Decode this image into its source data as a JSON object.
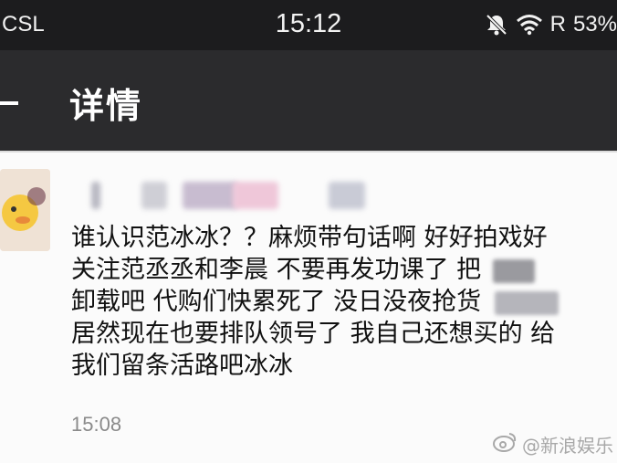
{
  "status_bar": {
    "carrier": "CSL",
    "time": "15:12",
    "network_label": "R",
    "battery": "53%",
    "icons": [
      "bell-muted-icon",
      "wifi-icon"
    ]
  },
  "header": {
    "back_icon": "back-arrow-icon",
    "title": "详情"
  },
  "message": {
    "lines": [
      "谁认识范冰冰？？麻烦带句话啊 好好拍戏好",
      "关注范丞丞和李晨 不要再发功课了 把",
      "卸载吧 代购们快累死了 没日没夜抢货",
      "居然现在也要排队领号了 我自己还想买的 给",
      "我们留条活路吧冰冰"
    ],
    "time": "15:08"
  },
  "watermark": {
    "text": "@新浪娱乐",
    "icon": "weibo-logo-icon"
  },
  "colors": {
    "status_bg": "#1c1c1e",
    "header_bg": "#2b2b2d",
    "page_bg": "#fbfbfb",
    "text": "#111111",
    "muted": "#8a8a8a"
  }
}
